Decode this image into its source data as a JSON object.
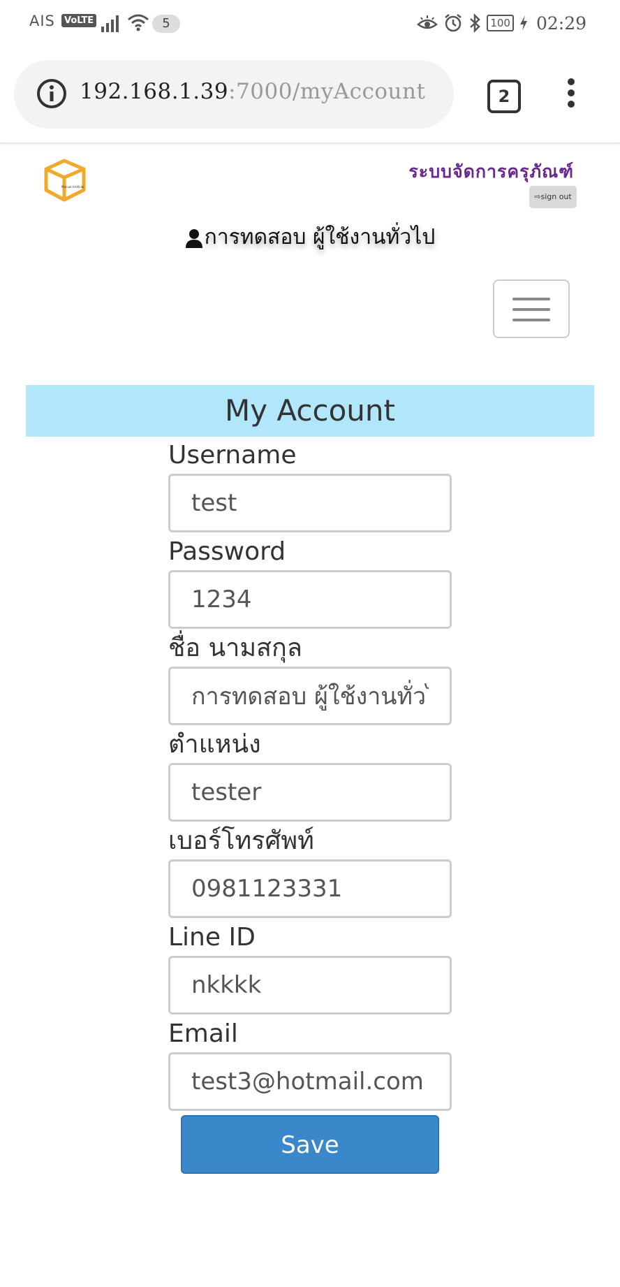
{
  "status_bar": {
    "carrier": "AIS",
    "volte": "VoLTE",
    "notification_count": "5",
    "battery": "100",
    "time": "02:29"
  },
  "browser": {
    "url_host": "192.168.1.39",
    "url_port": ":7000",
    "url_path": "/myAccount",
    "tab_count": "2"
  },
  "header": {
    "system_title": "ระบบจัดการครุภัณฑ์",
    "signout_label": "sign out",
    "logged_in_user": "การทดสอบ ผู้ใช้งานทั่วไป",
    "logo_text": "Manual Artificial"
  },
  "account": {
    "title": "My Account",
    "fields": [
      {
        "label": "Username",
        "value": "test"
      },
      {
        "label": "Password",
        "value": "1234"
      },
      {
        "label": "ชื่อ นามสกุล",
        "value": "การทดสอบ ผู้ใช้งานทั่วไป"
      },
      {
        "label": "ตำแหน่ง",
        "value": "tester"
      },
      {
        "label": "เบอร์โทรศัพท์",
        "value": "0981123331"
      },
      {
        "label": "Line ID",
        "value": "nkkkk"
      },
      {
        "label": "Email",
        "value": "test3@hotmail.com"
      }
    ],
    "save_label": "Save"
  },
  "colors": {
    "section_header_bg": "#b1e6fb",
    "save_button_bg": "#3a87c9",
    "system_title": "#6a2a8c",
    "logo": "#f0a92a"
  }
}
